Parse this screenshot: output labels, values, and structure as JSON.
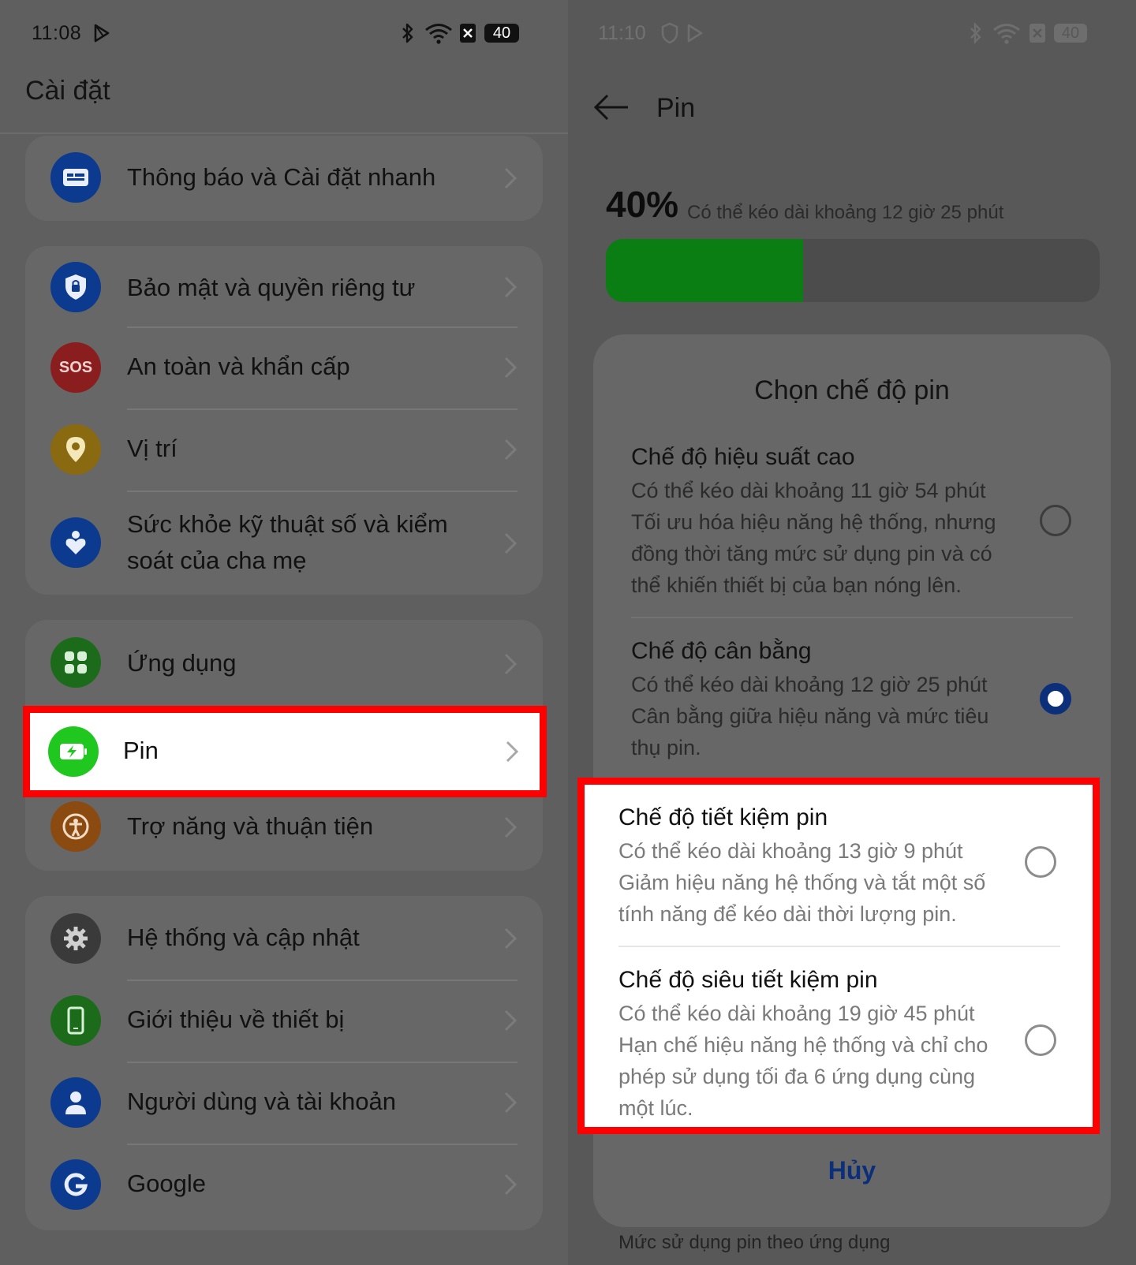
{
  "left": {
    "status": {
      "time": "11:08",
      "battery": "40"
    },
    "title": "Cài đặt",
    "groups": [
      {
        "items": [
          {
            "label": "Thông báo và Cài đặt nhanh",
            "icon": "notification-icon",
            "color": "#0b3a8f"
          }
        ]
      },
      {
        "items": [
          {
            "label": "Bảo mật và quyền riêng tư",
            "icon": "shield-lock-icon",
            "color": "#0b3a8f"
          },
          {
            "label": "An toàn và khẩn cấp",
            "icon": "sos-icon",
            "color": "#8a1d1d",
            "badge": "SOS"
          },
          {
            "label": "Vị trí",
            "icon": "location-pin-icon",
            "color": "#8a6a10"
          },
          {
            "label": "Sức khỏe kỹ thuật số và kiểm soát của cha mẹ",
            "icon": "heart-person-icon",
            "color": "#0b3a8f"
          }
        ]
      },
      {
        "items": [
          {
            "label": "Ứng dụng",
            "icon": "apps-grid-icon",
            "color": "#1b6b1b"
          },
          {
            "label": "Pin",
            "icon": "battery-charging-icon",
            "color": "#1fc71f"
          },
          {
            "label": "Trợ năng và thuận tiện",
            "icon": "accessibility-icon",
            "color": "#8a4a10"
          }
        ]
      },
      {
        "items": [
          {
            "label": "Hệ thống và cập nhật",
            "icon": "gear-icon",
            "color": "#3a3a3a"
          },
          {
            "label": "Giới thiệu về thiết bị",
            "icon": "phone-icon",
            "color": "#1b6b1b"
          },
          {
            "label": "Người dùng và tài khoản",
            "icon": "user-icon",
            "color": "#0b3a8f"
          },
          {
            "label": "Google",
            "icon": "google-icon",
            "color": "#0b3a8f"
          }
        ]
      }
    ]
  },
  "right": {
    "status": {
      "time": "11:10",
      "battery": "40"
    },
    "title": "Pin",
    "battery_percent_label": "40%",
    "battery_percent": 40,
    "battery_estimate": "Có thể kéo dài khoảng 12 giờ 25 phút",
    "sheet": {
      "title": "Chọn chế độ pin",
      "options": [
        {
          "title": "Chế độ hiệu suất cao",
          "desc": "Có thể kéo dài khoảng 11 giờ 54 phút Tối ưu hóa hiệu năng hệ thống, nhưng đồng thời tăng mức sử dụng pin và có thể khiến thiết bị của bạn nóng lên.",
          "selected": false
        },
        {
          "title": "Chế độ cân bằng",
          "desc": "Có thể kéo dài khoảng 12 giờ 25 phút Cân bằng giữa hiệu năng và mức tiêu thụ pin.",
          "selected": true
        },
        {
          "title": "Chế độ tiết kiệm pin",
          "desc": "Có thể kéo dài khoảng 13 giờ 9 phút Giảm hiệu năng hệ thống và tắt một số tính năng để kéo dài thời lượng pin.",
          "selected": false
        },
        {
          "title": "Chế độ siêu tiết kiệm pin",
          "desc": "Có thể kéo dài khoảng 19 giờ 45 phút Hạn chế hiệu năng hệ thống và chỉ cho phép sử dụng tối đa 6 ứng dụng cùng một lúc.",
          "selected": false
        }
      ],
      "cancel": "Hủy"
    },
    "footer": "Mức sử dụng pin theo ứng dụng"
  }
}
